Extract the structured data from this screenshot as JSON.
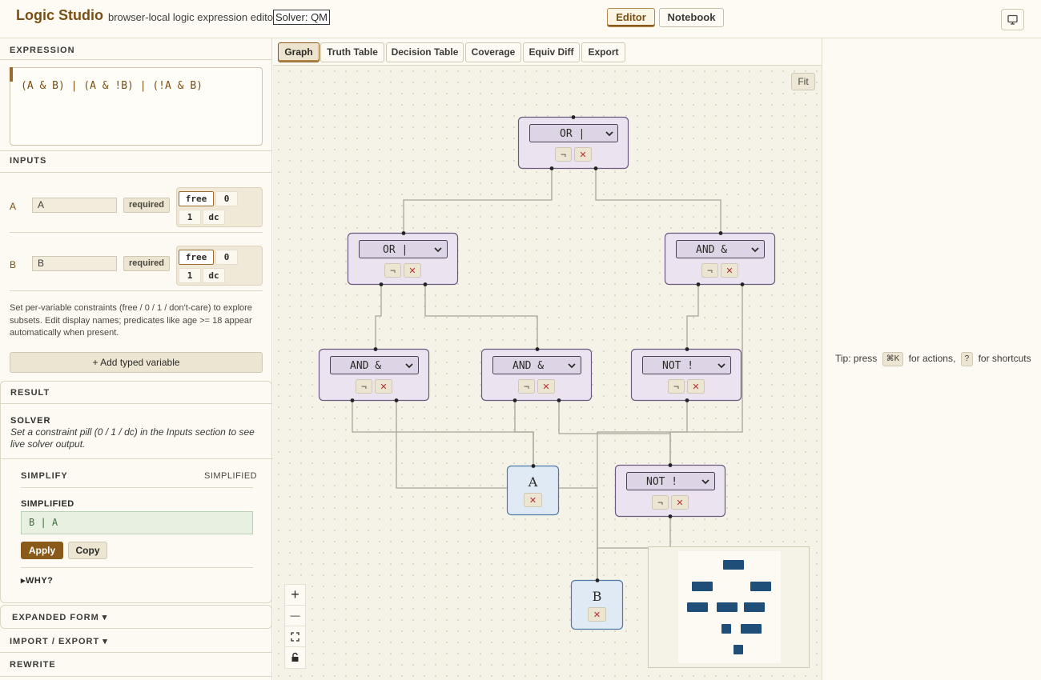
{
  "header": {
    "brand": "Logic Studio",
    "tagline": "browser-local logic expression editor",
    "solver_badge": "Solver: QM",
    "modes": [
      "Editor",
      "Notebook"
    ],
    "active_mode": "Editor"
  },
  "left": {
    "expression_title": "EXPRESSION",
    "expression": "(A & B) | (A & !B) | (!A & B)",
    "inputs_title": "INPUTS",
    "variables": [
      {
        "letter": "A",
        "name": "A",
        "required_label": "required",
        "pills": [
          "free",
          "0",
          "1",
          "dc"
        ],
        "selected_pill": "free"
      },
      {
        "letter": "B",
        "name": "B",
        "required_label": "required",
        "pills": [
          "free",
          "0",
          "1",
          "dc"
        ],
        "selected_pill": "free"
      }
    ],
    "help_text": "Set per-variable constraints (free / 0 / 1 / don't-care) to explore subsets. Edit display names; predicates like age  >=  18 appear automatically when present.",
    "add_variable_label": "+ Add typed variable",
    "result_title": "RESULT",
    "solver_title": "SOLVER",
    "solver_message": "Set a constraint pill (0 / 1 / dc) in the Inputs section to see live solver output.",
    "simplify_title": "SIMPLIFY",
    "simplify_status": "SIMPLIFIED",
    "simplified_label": "SIMPLIFIED",
    "simplified_expression": "B | A",
    "apply_label": "Apply",
    "copy_label": "Copy",
    "why_label": "▸WHY?",
    "expanded_form_label": "EXPANDED FORM ▾",
    "import_export_label": "IMPORT / EXPORT ▾",
    "rewrite_label": "REWRITE"
  },
  "tabs": [
    "Graph",
    "Truth Table",
    "Decision Table",
    "Coverage",
    "Equiv Diff",
    "Export"
  ],
  "active_tab": "Graph",
  "graph": {
    "fit_label": "Fit",
    "negate_glyph": "¬",
    "delete_glyph": "✕",
    "op_nodes": [
      {
        "id": "or-root",
        "op": "OR |"
      },
      {
        "id": "or-left",
        "op": "OR |"
      },
      {
        "id": "and-right",
        "op": "AND &"
      },
      {
        "id": "and-1",
        "op": "AND &"
      },
      {
        "id": "and-2",
        "op": "AND &"
      },
      {
        "id": "not-1",
        "op": "NOT !"
      },
      {
        "id": "not-2",
        "op": "NOT !"
      }
    ],
    "var_nodes": [
      {
        "id": "var-a",
        "label": "A"
      },
      {
        "id": "var-b",
        "label": "B"
      }
    ],
    "zoom_controls": {
      "zoom_in": "+",
      "zoom_out": "—"
    }
  },
  "right": {
    "tip_prefix": "Tip: press",
    "tip_key1": "⌘K",
    "tip_mid": "for actions,",
    "tip_key2": "?",
    "tip_suffix": "for shortcuts"
  },
  "colors": {
    "brand": "#7a4f14",
    "op_node_fill": "#ebe4f0",
    "op_node_border": "#6d5a82",
    "var_node_fill": "#dfeaf5",
    "var_node_border": "#4f7aa8",
    "minimap_block": "#1f4e79",
    "delete_red": "#b03030"
  }
}
